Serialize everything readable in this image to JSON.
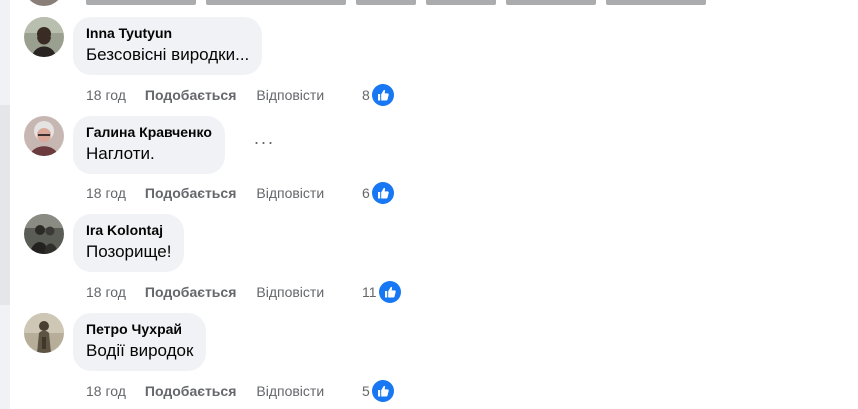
{
  "comments": [
    {
      "author": "Inna Tyutyun",
      "text": "Безсовісні виродки...",
      "time": "18 год",
      "like_label": "Подобається",
      "reply_label": "Відповісти",
      "reactions": "8",
      "avatar": "avatar-inna"
    },
    {
      "author": "Галина Кравченко",
      "text": "Наглоти.",
      "time": "18 год",
      "like_label": "Подобається",
      "reply_label": "Відповісти",
      "reactions": "6",
      "more": "···",
      "avatar": "avatar-galyna"
    },
    {
      "author": "Ira Kolontaj",
      "text": "Позорище!",
      "time": "18 год",
      "like_label": "Подобається",
      "reply_label": "Відповісти",
      "reactions": "11",
      "avatar": "avatar-ira"
    },
    {
      "author": "Петро Чухрай",
      "text": "Водії виродок",
      "time": "18 год",
      "like_label": "Подобається",
      "reply_label": "Відповісти",
      "reactions": "5",
      "avatar": "avatar-petro"
    }
  ],
  "icons": {
    "like": "like-thumb-icon",
    "more": "more-options-icon"
  },
  "colors": {
    "bubble": "#f0f2f5",
    "meta_text": "#65676b",
    "like_blue": "#1877f2"
  }
}
